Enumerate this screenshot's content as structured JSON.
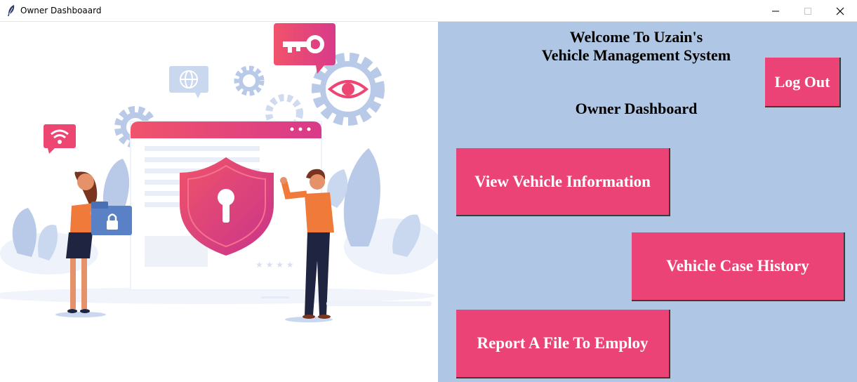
{
  "window": {
    "title": "Owner Dashboaard",
    "icon": "feather-icon"
  },
  "header": {
    "welcome_line1": "Welcome To Uzain's",
    "welcome_line2": "Vehicle Management System",
    "dashboard_title": "Owner Dashboard"
  },
  "buttons": {
    "logout": "Log Out",
    "view_vehicle": "View Vehicle Information",
    "case_history": "Vehicle Case History",
    "report_file": "Report A File To Employ"
  },
  "colors": {
    "panel_bg": "#afc6e4",
    "button_bg": "#ec4376",
    "accent_pink": "#ee4672",
    "illustration_blue": "#b8cae8"
  }
}
